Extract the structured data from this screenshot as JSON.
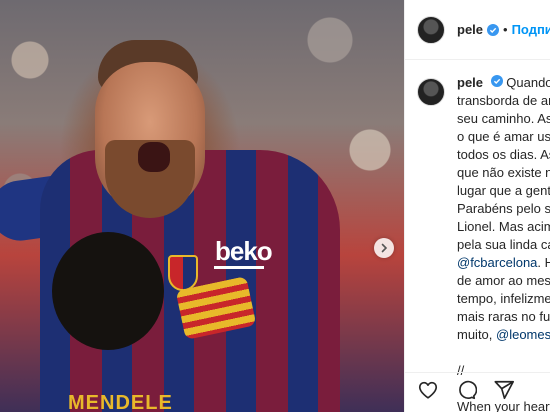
{
  "post": {
    "image_jersey_text": "MENDELE",
    "image_sponsor_text": "beko"
  },
  "header": {
    "username": "pele",
    "follow_label": "Подписаться"
  },
  "caption": {
    "username": "pele",
    "lines": [
      "Quando se",
      "transborda de amo",
      "seu caminho. Assi",
      "o que é amar usar",
      "todos os dias. Ass",
      "que não existe nad",
      "lugar que a gente",
      "Parabéns pelo seu",
      "Lionel. Mas acima",
      "pela sua linda carr"
    ],
    "tag_fcbarcelona": "@fcbarcelona",
    "line_after_tag": ". His",
    "lines_2": [
      "de amor ao mesm",
      "tempo, infelizment",
      "mais raras no fute"
    ],
    "line_muito": "muito, ",
    "tag_leomessi": "@leomessi",
    "line_after_leomessi": ".",
    "separator": "//",
    "english_line": "When your heart c"
  },
  "icons": {
    "verified": "verified-badge-icon",
    "next": "chevron-right-icon",
    "like": "heart-icon",
    "comment": "comment-icon",
    "share": "send-icon"
  },
  "colors": {
    "follow": "#0095f6",
    "verified": "#3897f0",
    "tag": "#00376b"
  }
}
